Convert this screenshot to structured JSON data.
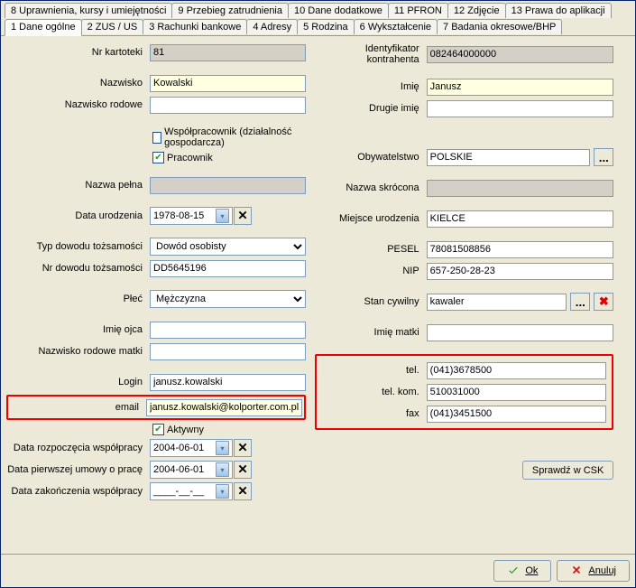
{
  "tabs_top": [
    "8 Uprawnienia, kursy i umiejętności",
    "9 Przebieg zatrudnienia",
    "10 Dane dodatkowe",
    "11 PFRON",
    "12 Zdjęcie",
    "13 Prawa do aplikacji"
  ],
  "tabs_bottom": [
    "1 Dane ogólne",
    "2 ZUS / US",
    "3 Rachunki bankowe",
    "4 Adresy",
    "5 Rodzina",
    "6 Wykształcenie",
    "7 Badania okresowe/BHP"
  ],
  "left": {
    "nr_kartoteki_lbl": "Nr kartoteki",
    "nr_kartoteki": "81",
    "nazwisko_lbl": "Nazwisko",
    "nazwisko": "Kowalski",
    "nazwisko_rodowe_lbl": "Nazwisko rodowe",
    "nazwisko_rodowe": "",
    "wspolpracownik_lbl": "Współpracownik (działalność gospodarcza)",
    "pracownik_lbl": "Pracownik",
    "nazwa_pelna_lbl": "Nazwa pełna",
    "nazwa_pelna": "",
    "data_ur_lbl": "Data urodzenia",
    "data_ur": "1978-08-15",
    "typ_dow_lbl": "Typ dowodu tożsamości",
    "typ_dow": "Dowód osobisty",
    "nr_dow_lbl": "Nr dowodu tożsamości",
    "nr_dow": "DD5645196",
    "plec_lbl": "Płeć",
    "plec": "Mężczyzna",
    "imie_ojca_lbl": "Imię ojca",
    "imie_ojca": "",
    "nazw_rod_matki_lbl": "Nazwisko rodowe matki",
    "nazw_rod_matki": "",
    "login_lbl": "Login",
    "login": "janusz.kowalski",
    "email_lbl": "email",
    "email": "janusz.kowalski@kolporter.com.pl",
    "aktywny_lbl": "Aktywny",
    "data_rozp_lbl": "Data rozpoczęcia współpracy",
    "data_rozp": "2004-06-01",
    "data_pierw_lbl": "Data pierwszej umowy o pracę",
    "data_pierw": "2004-06-01",
    "data_zak_lbl": "Data zakończenia współpracy",
    "data_zak": "____-__-__"
  },
  "right": {
    "id_kontr_lbl": "Identyfikator kontrahenta",
    "id_kontr": "082464000000",
    "imie_lbl": "Imię",
    "imie": "Janusz",
    "drugie_lbl": "Drugie imię",
    "drugie": "",
    "obyw_lbl": "Obywatelstwo",
    "obyw": "POLSKIE",
    "nazwa_skr_lbl": "Nazwa skrócona",
    "nazwa_skr": "",
    "miejsce_ur_lbl": "Miejsce urodzenia",
    "miejsce_ur": "KIELCE",
    "pesel_lbl": "PESEL",
    "pesel": "78081508856",
    "nip_lbl": "NIP",
    "nip": "657-250-28-23",
    "stan_lbl": "Stan cywilny",
    "stan": "kawaler",
    "imie_matki_lbl": "Imię matki",
    "imie_matki": "",
    "tel_lbl": "tel.",
    "tel": "(041)3678500",
    "telkom_lbl": "tel. kom.",
    "telkom": "510031000",
    "fax_lbl": "fax",
    "fax": "(041)3451500"
  },
  "buttons": {
    "sprawdz": "Sprawdź w CSK",
    "ok": "Ok",
    "anuluj": "Anuluj"
  }
}
